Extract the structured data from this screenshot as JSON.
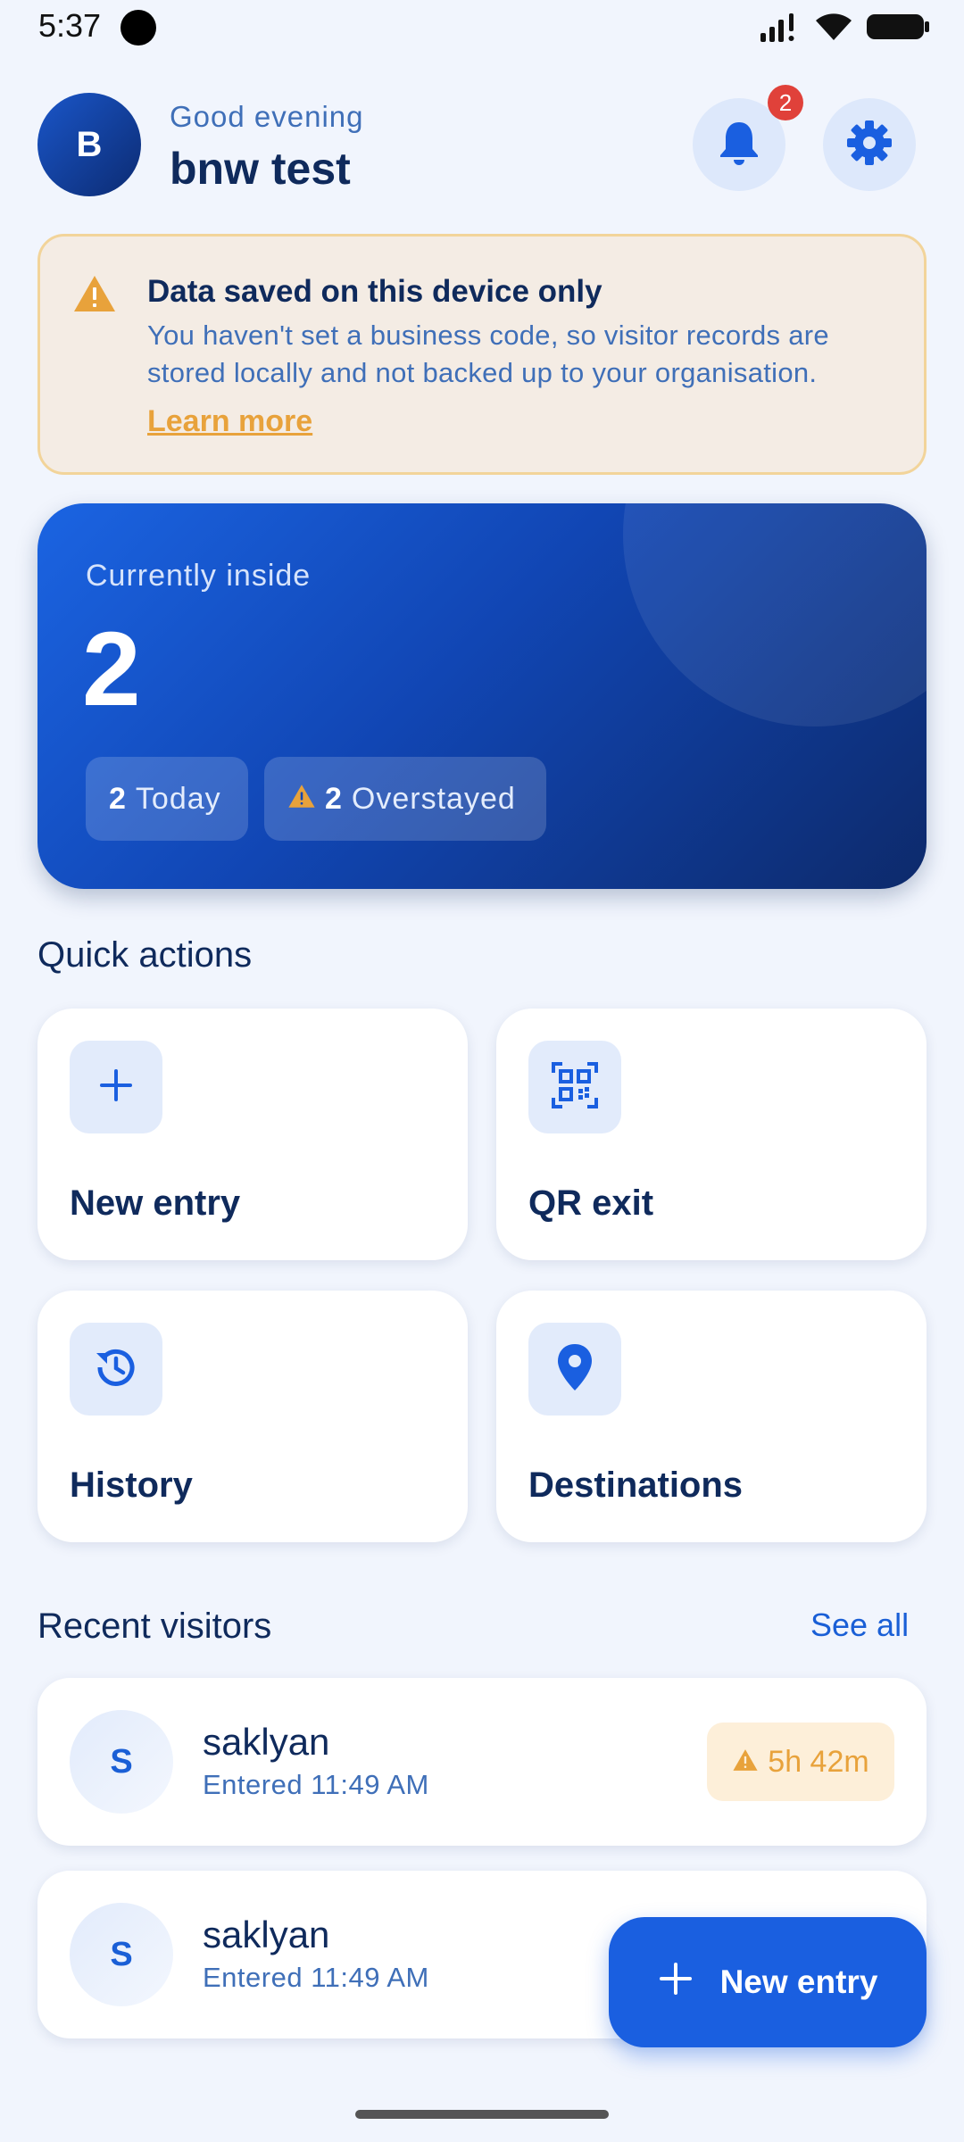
{
  "status_bar": {
    "time": "5:37",
    "icons": [
      "signal-icon",
      "wifi-icon",
      "battery-icon"
    ]
  },
  "header": {
    "avatar_initial": "B",
    "greeting": "Good evening",
    "user_name": "bnw test",
    "notification_count": "2",
    "icons": [
      "bell-icon",
      "gear-icon"
    ]
  },
  "warning": {
    "title": "Data saved on this device only",
    "body": "You haven't set a business code, so visitor records are stored locally and not backed up to your organisation.",
    "link": "Learn more",
    "icon": "warning-icon",
    "color": "#e8a23b"
  },
  "stats": {
    "label": "Currently inside",
    "count": "2",
    "today_value": "2",
    "today_label": "Today",
    "overstayed_value": "2",
    "overstayed_label": "Overstayed"
  },
  "quick_actions": {
    "title": "Quick actions",
    "items": [
      {
        "label": "New entry",
        "icon": "plus-icon"
      },
      {
        "label": "QR exit",
        "icon": "qr-code-icon"
      },
      {
        "label": "History",
        "icon": "history-icon"
      },
      {
        "label": "Destinations",
        "icon": "location-pin-icon"
      }
    ]
  },
  "recent": {
    "title": "Recent visitors",
    "see_all": "See all",
    "visitors": [
      {
        "initial": "S",
        "name": "saklyan",
        "entered": "Entered 11:49 AM",
        "duration": "5h 42m"
      },
      {
        "initial": "S",
        "name": "saklyan",
        "entered": "Entered 11:49 AM"
      }
    ]
  },
  "fab": {
    "label": "New entry",
    "icon": "plus-icon"
  },
  "colors": {
    "accent": "#1a5fe0",
    "navy": "#0f2a5c",
    "warning": "#e8a23b",
    "badge_red": "#e0413a"
  }
}
